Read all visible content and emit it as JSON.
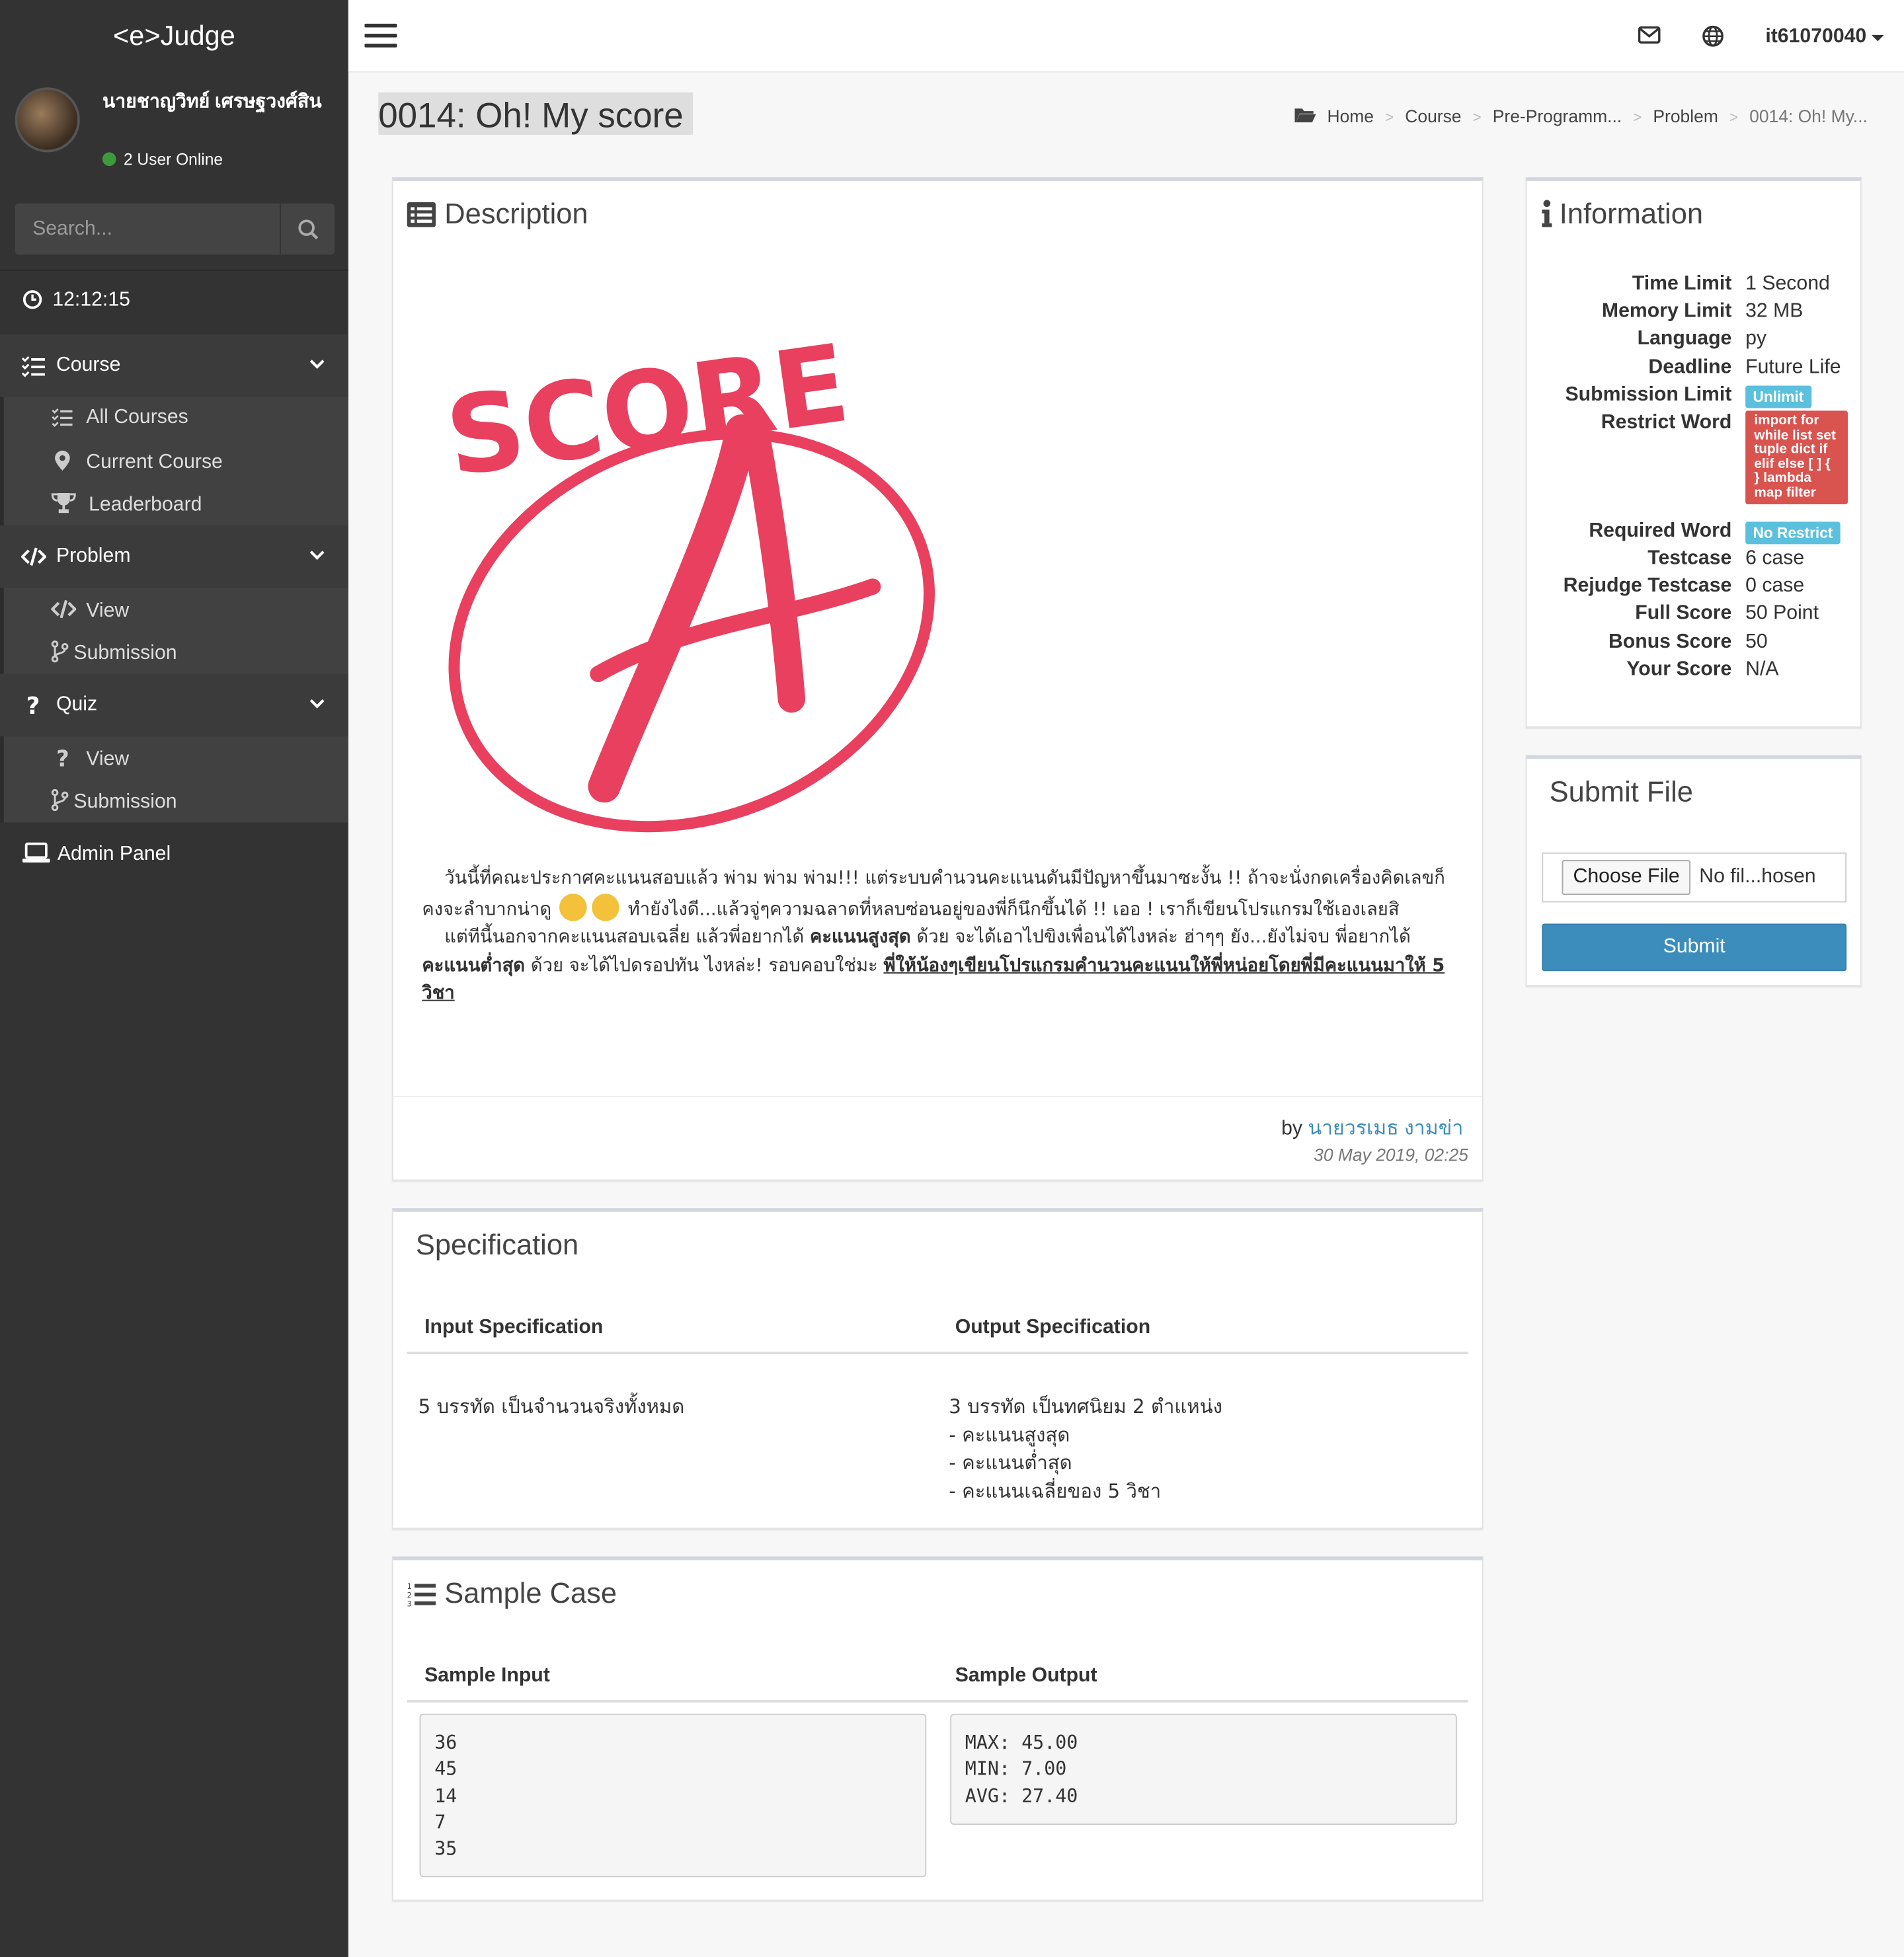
{
  "app": {
    "brand": "<e>Judge"
  },
  "user": {
    "name": "นายชาญวิทย์ เศรษฐวงศ์สิน",
    "online": "2 User Online",
    "username": "it61070040"
  },
  "search": {
    "placeholder": "Search..."
  },
  "clock": "12:12:15",
  "sidebar": {
    "course": {
      "label": "Course",
      "items": [
        "All Courses",
        "Current Course",
        "Leaderboard"
      ]
    },
    "problem": {
      "label": "Problem",
      "items": [
        "View",
        "Submission"
      ]
    },
    "quiz": {
      "label": "Quiz",
      "items": [
        "View",
        "Submission"
      ]
    },
    "admin": "Admin Panel"
  },
  "page": {
    "title": "0014: Oh! My score"
  },
  "breadcrumb": [
    "Home",
    "Course",
    "Pre-Programm...",
    "Problem",
    "0014: Oh! My..."
  ],
  "description": {
    "title": "Description",
    "image_text": {
      "top": "SCORE",
      "grade": "A"
    },
    "p1_a": "วันนี้ที่คณะประกาศคะแนนสอบแล้ว พ่าม พ่าม พ่าม!!! แต่ระบบคำนวนคะแนนดันมีปัญหาขึ้นมาซะงั้น !! ถ้าจะนั่งกดเครื่องคิดเลขก็คงจะลำบากน่าดู ",
    "p1_b": " ทำยังไงดี...แล้วจู่ๆความฉลาดที่หลบซ่อนอยู่ของพี่ก็นึกขึ้นได้ !!  เออ ! เราก็เขียนโปรแกรมใช้เองเลยสิ",
    "p2_a": "แต่ทีนี้นอกจากคะแนนสอบเฉลี่ย แล้วพี่อยากได้ ",
    "p2_b1": "คะแนนสูงสุด",
    "p2_c": " ด้วย จะได้เอาไปขิงเพื่อนได้ไงหล่ะ ฮ่าๆๆ ยัง...ยังไม่จบ พี่อยากได้ ",
    "p2_b2": "คะแนนต่ำสุด",
    "p2_d": " ด้วย จะได้ไปดรอปทัน ไงหล่ะ! รอบคอบใช่มะ ",
    "p2_u": "พี่ให้น้องๆเขียนโปรแกรมคำนวนคะแนนให้พี่หน่อยโดยพี่มีคะแนนมาให้ 5 วิชา",
    "by_prefix": "by ",
    "author": "นายวรเมธ งามข่า",
    "date": "30 May 2019, 02:25"
  },
  "information": {
    "title": "Information",
    "rows": [
      {
        "k": "Time Limit",
        "v": "1 Second"
      },
      {
        "k": "Memory Limit",
        "v": "32 MB"
      },
      {
        "k": "Language",
        "v": "py"
      },
      {
        "k": "Deadline",
        "v": "Future Life"
      },
      {
        "k": "Submission Limit",
        "v": "Unlimit"
      },
      {
        "k": "Restrict Word",
        "v": "import for while list set tuple dict if elif else [ ] { } lambda map filter"
      },
      {
        "k": "Required Word",
        "v": "No Restrict"
      },
      {
        "k": "Testcase",
        "v": "6 case"
      },
      {
        "k": "Rejudge Testcase",
        "v": "0 case"
      },
      {
        "k": "Full Score",
        "v": "50 Point"
      },
      {
        "k": "Bonus Score",
        "v": "50"
      },
      {
        "k": "Your Score",
        "v": "N/A"
      }
    ],
    "colors": {
      "label_info": "#5bc0de",
      "label_danger": "#d9534f"
    }
  },
  "submit_file": {
    "title": "Submit File",
    "choose": "Choose File",
    "no_file": "No fil...hosen",
    "submit": "Submit"
  },
  "specification": {
    "title": "Specification",
    "input_head": "Input Specification",
    "output_head": "Output Specification",
    "input": "5 บรรทัด เป็นจำนวนจริงทั้งหมด",
    "output": [
      "3 บรรทัด เป็นทศนิยม 2 ตำแหน่ง",
      "- คะแนนสูงสุด",
      "- คะแนนต่ำสุด",
      "- คะแนนเฉลี่ยของ 5 วิชา"
    ]
  },
  "sample": {
    "title": "Sample Case",
    "input_head": "Sample Input",
    "output_head": "Sample Output",
    "input": "36\n45\n14\n7\n35",
    "output": "MAX: 45.00\nMIN: 7.00\nAVG: 27.40"
  }
}
